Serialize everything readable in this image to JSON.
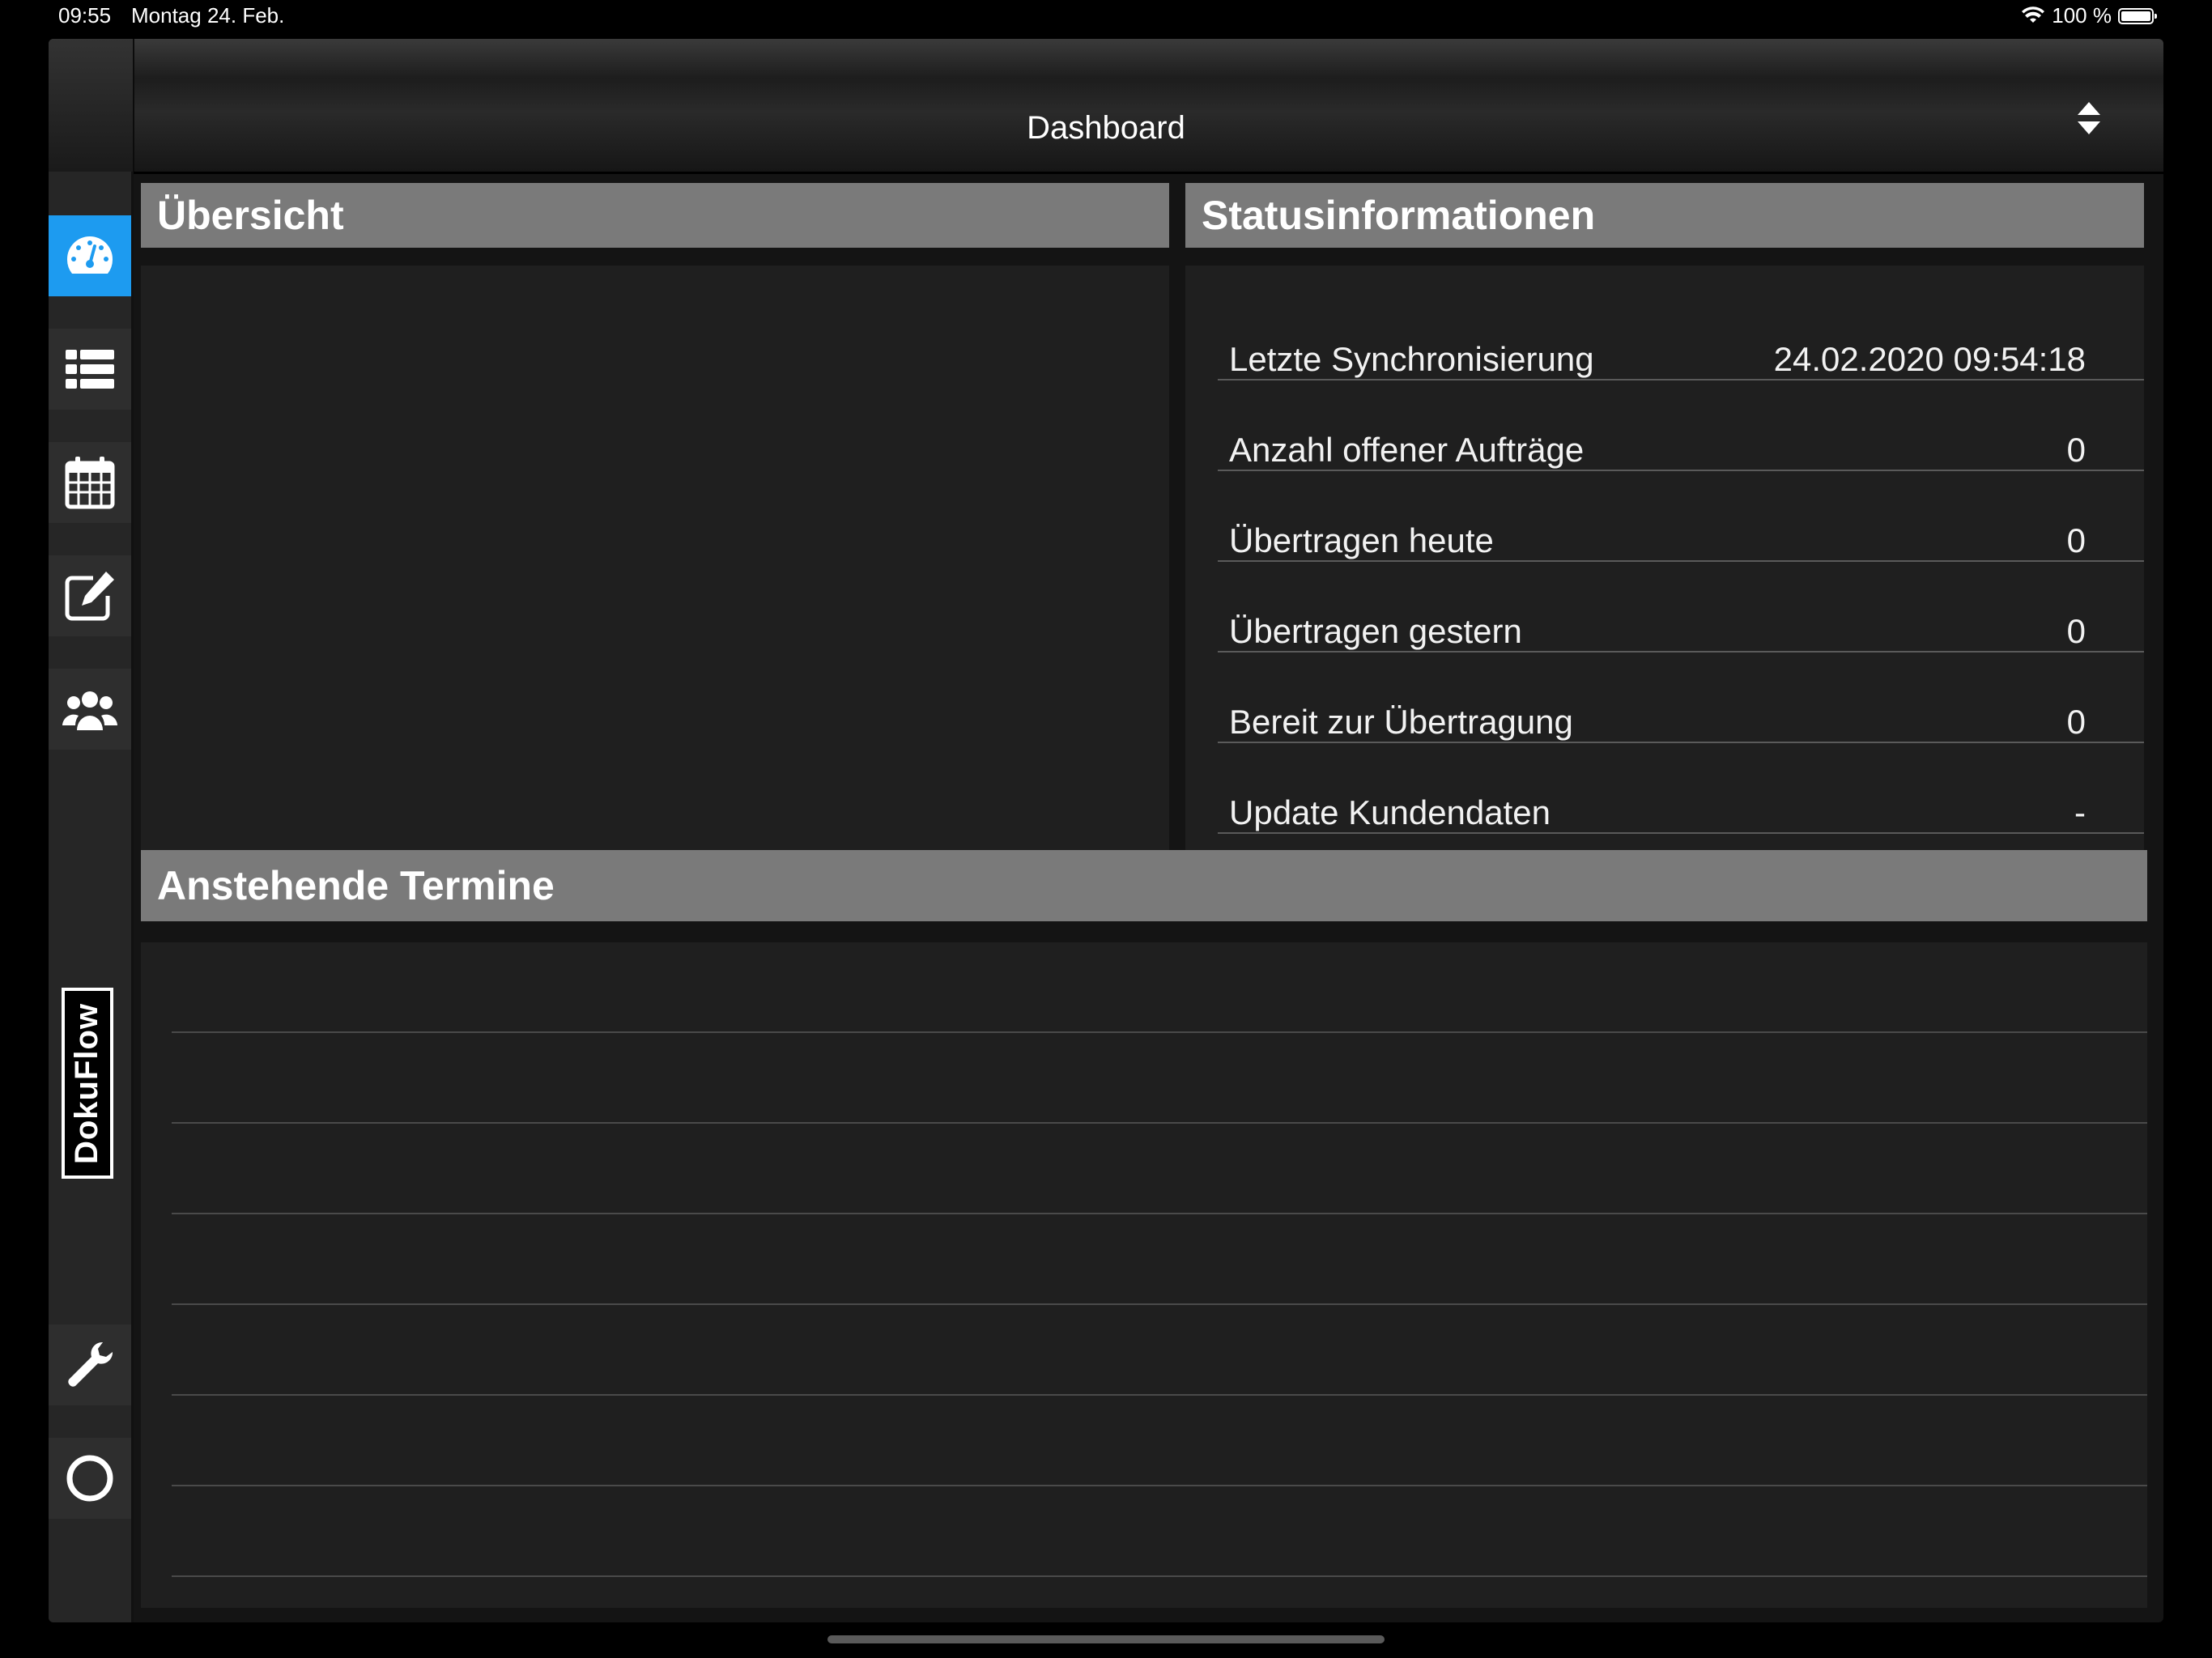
{
  "status_bar": {
    "time": "09:55",
    "date": "Montag 24. Feb.",
    "battery": "100 %"
  },
  "navbar": {
    "title": "Dashboard"
  },
  "sidebar": {
    "active_color": "#1d9bf0",
    "items": [
      {
        "icon": "dashboard-gauge-icon",
        "active": true
      },
      {
        "icon": "list-icon",
        "active": false
      },
      {
        "icon": "calendar-icon",
        "active": false
      },
      {
        "icon": "edit-icon",
        "active": false
      },
      {
        "icon": "users-icon",
        "active": false
      },
      {
        "icon": "wrench-icon",
        "active": false
      },
      {
        "icon": "circle-icon",
        "active": false
      }
    ],
    "brand": "DokuFlow"
  },
  "overview": {
    "title": "Übersicht"
  },
  "status_info": {
    "title": "Statusinformationen",
    "rows": [
      {
        "label": "Letzte Synchronisierung",
        "value": "24.02.2020 09:54:18"
      },
      {
        "label": "Anzahl offener Aufträge",
        "value": "0"
      },
      {
        "label": "Übertragen heute",
        "value": "0"
      },
      {
        "label": "Übertragen gestern",
        "value": "0"
      },
      {
        "label": "Bereit zur Übertragung",
        "value": "0"
      },
      {
        "label": "Update Kundendaten",
        "value": "-"
      }
    ]
  },
  "appointments": {
    "title": "Anstehende Termine",
    "rows": []
  }
}
